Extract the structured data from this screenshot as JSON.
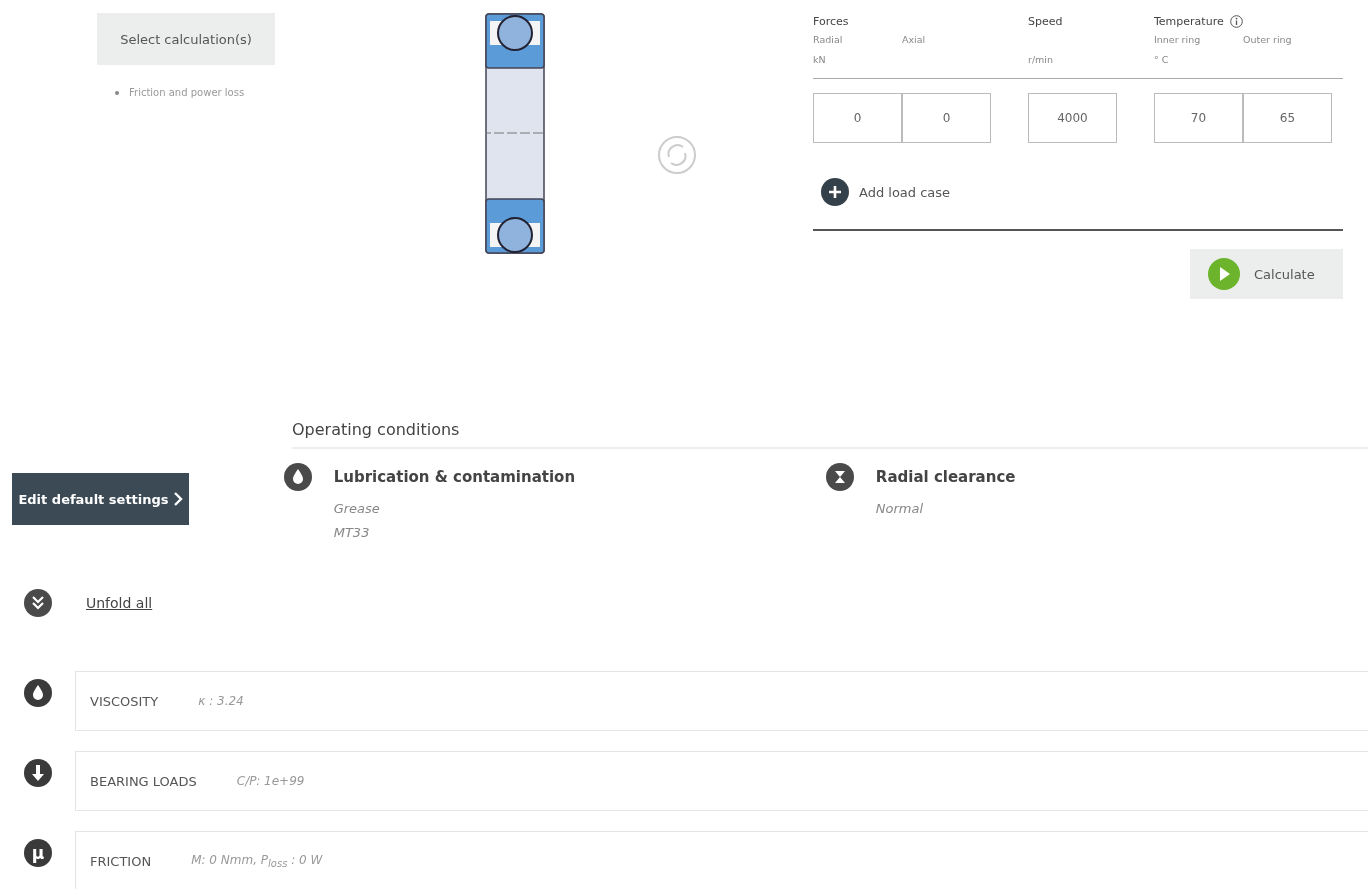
{
  "calculations": {
    "button": "Select calculation(s)",
    "selected": [
      "Friction and power loss"
    ]
  },
  "load_table": {
    "groups": [
      {
        "title": "Forces",
        "columns": [
          {
            "label": "Radial",
            "unit": "kN",
            "value": "0"
          },
          {
            "label": "Axial",
            "value": "0"
          }
        ]
      },
      {
        "title": "Speed",
        "columns": [
          {
            "unit": "r/min",
            "value": "4000"
          }
        ]
      },
      {
        "title": "Temperature",
        "info": true,
        "columns": [
          {
            "label": "Inner ring",
            "unit": "° C",
            "value": "70"
          },
          {
            "label": "Outer ring",
            "value": "65"
          }
        ]
      }
    ],
    "add_button": "Add load case",
    "calculate_button": "Calculate"
  },
  "operating_conditions": {
    "title": "Operating conditions",
    "edit_button": "Edit default settings",
    "items": [
      {
        "kind": "drop",
        "title": "Lubrication & contamination",
        "values": [
          "Grease",
          "MT33"
        ]
      },
      {
        "kind": "clearance",
        "title": "Radial clearance",
        "values": [
          "Normal"
        ]
      }
    ]
  },
  "unfold_link": "Unfold all",
  "results": [
    {
      "kind": "drop",
      "title": "VISCOSITY",
      "value": "κ : 3.24"
    },
    {
      "kind": "load",
      "title": "BEARING LOADS",
      "value": "C/P: 1e+99"
    },
    {
      "kind": "glyph",
      "glyph": "μ",
      "title": "FRICTION",
      "value": "M: 0 Nmm, P$_{loss}$ : 0 W"
    }
  ]
}
